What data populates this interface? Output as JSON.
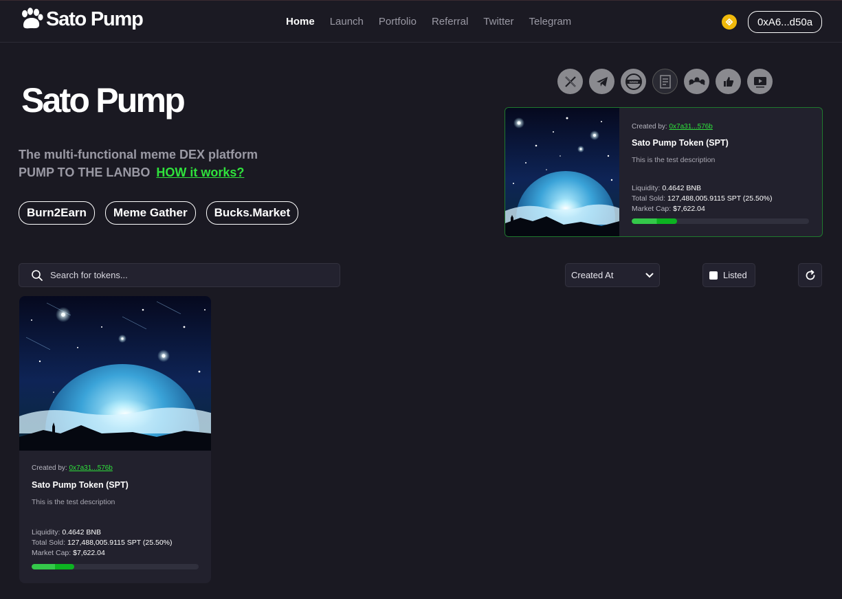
{
  "nav": {
    "brand": "Sato Pump",
    "items": [
      {
        "label": "Home",
        "active": true
      },
      {
        "label": "Launch",
        "active": false
      },
      {
        "label": "Portfolio",
        "active": false
      },
      {
        "label": "Referral",
        "active": false
      },
      {
        "label": "Twitter",
        "active": false
      },
      {
        "label": "Telegram",
        "active": false
      }
    ],
    "chain_icon": "bnb-icon",
    "wallet": "0xA6...d50a"
  },
  "hero": {
    "title": "Sato Pump",
    "tagline_line1": "The multi-functional meme DEX platform",
    "tagline_line2": "PUMP TO THE LANBO",
    "how_link": "HOW it works?",
    "buttons": [
      "Burn2Earn",
      "Meme Gather",
      "Bucks.Market"
    ]
  },
  "socials": [
    "x-icon",
    "telegram-icon",
    "website-icon",
    "document-icon",
    "coin-logo-icon",
    "thumbs-up-icon",
    "video-icon"
  ],
  "featured": {
    "created_by_label": "Created by:",
    "creator": "0x7a31...576b",
    "name": "Sato Pump Token (SPT)",
    "description": "This is the test description",
    "liquidity_label": "Liquidity:",
    "liquidity": "0.4642 BNB",
    "sold_label": "Total Sold:",
    "sold": "127,488,005.9115 SPT (25.50%)",
    "mcap_label": "Market Cap:",
    "mcap": "$7,622.04",
    "progress": 0.255
  },
  "filters": {
    "search_placeholder": "Search for tokens...",
    "sort": "Created At",
    "listed_label": "Listed",
    "listed_checked": false
  },
  "tokens": [
    {
      "created_by_label": "Created by:",
      "creator": "0x7a31...576b",
      "name": "Sato Pump Token (SPT)",
      "description": "This is the test description",
      "liquidity_label": "Liquidity:",
      "liquidity": "0.4642 BNB",
      "sold_label": "Total Sold:",
      "sold": "127,488,005.9115 SPT (25.50%)",
      "mcap_label": "Market Cap:",
      "mcap": "$7,622.04",
      "progress": 0.255
    }
  ],
  "colors": {
    "background": "#1a1922",
    "accent": "#2fe23c",
    "card": "#22212d",
    "featured_border": "#1f7a2e",
    "chain": "#f0b90b"
  }
}
